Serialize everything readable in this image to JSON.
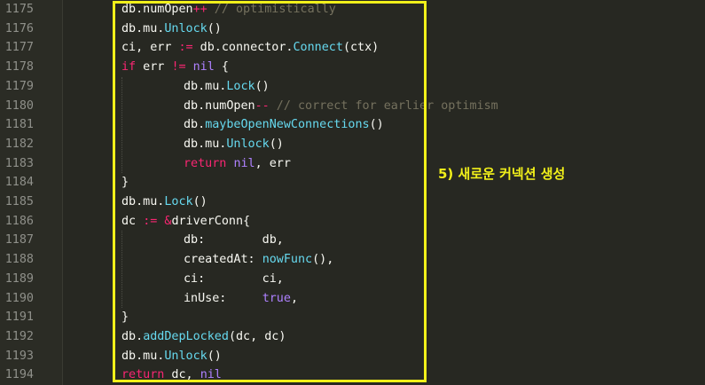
{
  "editor": {
    "lines": [
      {
        "no": "1175",
        "indent": 0,
        "tokens": [
          {
            "t": "db.numOpen",
            "c": "id"
          },
          {
            "t": "++",
            "c": "op"
          },
          {
            "t": " // optimistically",
            "c": "cm"
          }
        ]
      },
      {
        "no": "1176",
        "indent": 0,
        "tokens": [
          {
            "t": "db.mu.",
            "c": "id"
          },
          {
            "t": "Unlock",
            "c": "fn"
          },
          {
            "t": "()",
            "c": "id"
          }
        ]
      },
      {
        "no": "1177",
        "indent": 0,
        "tokens": [
          {
            "t": "ci, err ",
            "c": "id"
          },
          {
            "t": ":=",
            "c": "op"
          },
          {
            "t": " db.connector.",
            "c": "id"
          },
          {
            "t": "Connect",
            "c": "fn"
          },
          {
            "t": "(ctx)",
            "c": "id"
          }
        ]
      },
      {
        "no": "1178",
        "indent": 0,
        "tokens": [
          {
            "t": "if",
            "c": "kw"
          },
          {
            "t": " err ",
            "c": "id"
          },
          {
            "t": "!=",
            "c": "op"
          },
          {
            "t": " ",
            "c": "id"
          },
          {
            "t": "nil",
            "c": "const"
          },
          {
            "t": " {",
            "c": "id"
          }
        ]
      },
      {
        "no": "1179",
        "indent": 1,
        "tokens": [
          {
            "t": "db.mu.",
            "c": "id"
          },
          {
            "t": "Lock",
            "c": "fn"
          },
          {
            "t": "()",
            "c": "id"
          }
        ]
      },
      {
        "no": "1180",
        "indent": 1,
        "tokens": [
          {
            "t": "db.numOpen",
            "c": "id"
          },
          {
            "t": "--",
            "c": "op"
          },
          {
            "t": " // correct for earlier optimism",
            "c": "cm"
          }
        ]
      },
      {
        "no": "1181",
        "indent": 1,
        "tokens": [
          {
            "t": "db.",
            "c": "id"
          },
          {
            "t": "maybeOpenNewConnections",
            "c": "fn"
          },
          {
            "t": "()",
            "c": "id"
          }
        ]
      },
      {
        "no": "1182",
        "indent": 1,
        "tokens": [
          {
            "t": "db.mu.",
            "c": "id"
          },
          {
            "t": "Unlock",
            "c": "fn"
          },
          {
            "t": "()",
            "c": "id"
          }
        ]
      },
      {
        "no": "1183",
        "indent": 1,
        "tokens": [
          {
            "t": "return",
            "c": "kw"
          },
          {
            "t": " ",
            "c": "id"
          },
          {
            "t": "nil",
            "c": "const"
          },
          {
            "t": ", err",
            "c": "id"
          }
        ]
      },
      {
        "no": "1184",
        "indent": 0,
        "tokens": [
          {
            "t": "}",
            "c": "id"
          }
        ]
      },
      {
        "no": "1185",
        "indent": 0,
        "tokens": [
          {
            "t": "db.mu.",
            "c": "id"
          },
          {
            "t": "Lock",
            "c": "fn"
          },
          {
            "t": "()",
            "c": "id"
          }
        ]
      },
      {
        "no": "1186",
        "indent": 0,
        "tokens": [
          {
            "t": "dc ",
            "c": "id"
          },
          {
            "t": ":=",
            "c": "op"
          },
          {
            "t": " ",
            "c": "id"
          },
          {
            "t": "&",
            "c": "op"
          },
          {
            "t": "driverConn{",
            "c": "id"
          }
        ]
      },
      {
        "no": "1187",
        "indent": 1,
        "tokens": [
          {
            "t": "db:        db,",
            "c": "id"
          }
        ]
      },
      {
        "no": "1188",
        "indent": 1,
        "tokens": [
          {
            "t": "createdAt: ",
            "c": "id"
          },
          {
            "t": "nowFunc",
            "c": "fn"
          },
          {
            "t": "(),",
            "c": "id"
          }
        ]
      },
      {
        "no": "1189",
        "indent": 1,
        "tokens": [
          {
            "t": "ci:        ci,",
            "c": "id"
          }
        ]
      },
      {
        "no": "1190",
        "indent": 1,
        "tokens": [
          {
            "t": "inUse:     ",
            "c": "id"
          },
          {
            "t": "true",
            "c": "const"
          },
          {
            "t": ",",
            "c": "id"
          }
        ]
      },
      {
        "no": "1191",
        "indent": 0,
        "tokens": [
          {
            "t": "}",
            "c": "id"
          }
        ]
      },
      {
        "no": "1192",
        "indent": 0,
        "tokens": [
          {
            "t": "db.",
            "c": "id"
          },
          {
            "t": "addDepLocked",
            "c": "fn"
          },
          {
            "t": "(dc, dc)",
            "c": "id"
          }
        ]
      },
      {
        "no": "1193",
        "indent": 0,
        "tokens": [
          {
            "t": "db.mu.",
            "c": "id"
          },
          {
            "t": "Unlock",
            "c": "fn"
          },
          {
            "t": "()",
            "c": "id"
          }
        ]
      },
      {
        "no": "1194",
        "indent": 0,
        "tokens": [
          {
            "t": "return",
            "c": "kw"
          },
          {
            "t": " dc, ",
            "c": "id"
          },
          {
            "t": "nil",
            "c": "const"
          }
        ]
      }
    ]
  },
  "annotation": {
    "text": "5) 새로운 커넥션 생성"
  },
  "colors": {
    "background": "#272822",
    "highlight_box": "#f1f01a",
    "keyword": "#f92672",
    "function": "#66d9ef",
    "constant": "#ae81ff",
    "comment": "#75715e",
    "text": "#f8f8f2",
    "line_number": "#8f908a"
  }
}
